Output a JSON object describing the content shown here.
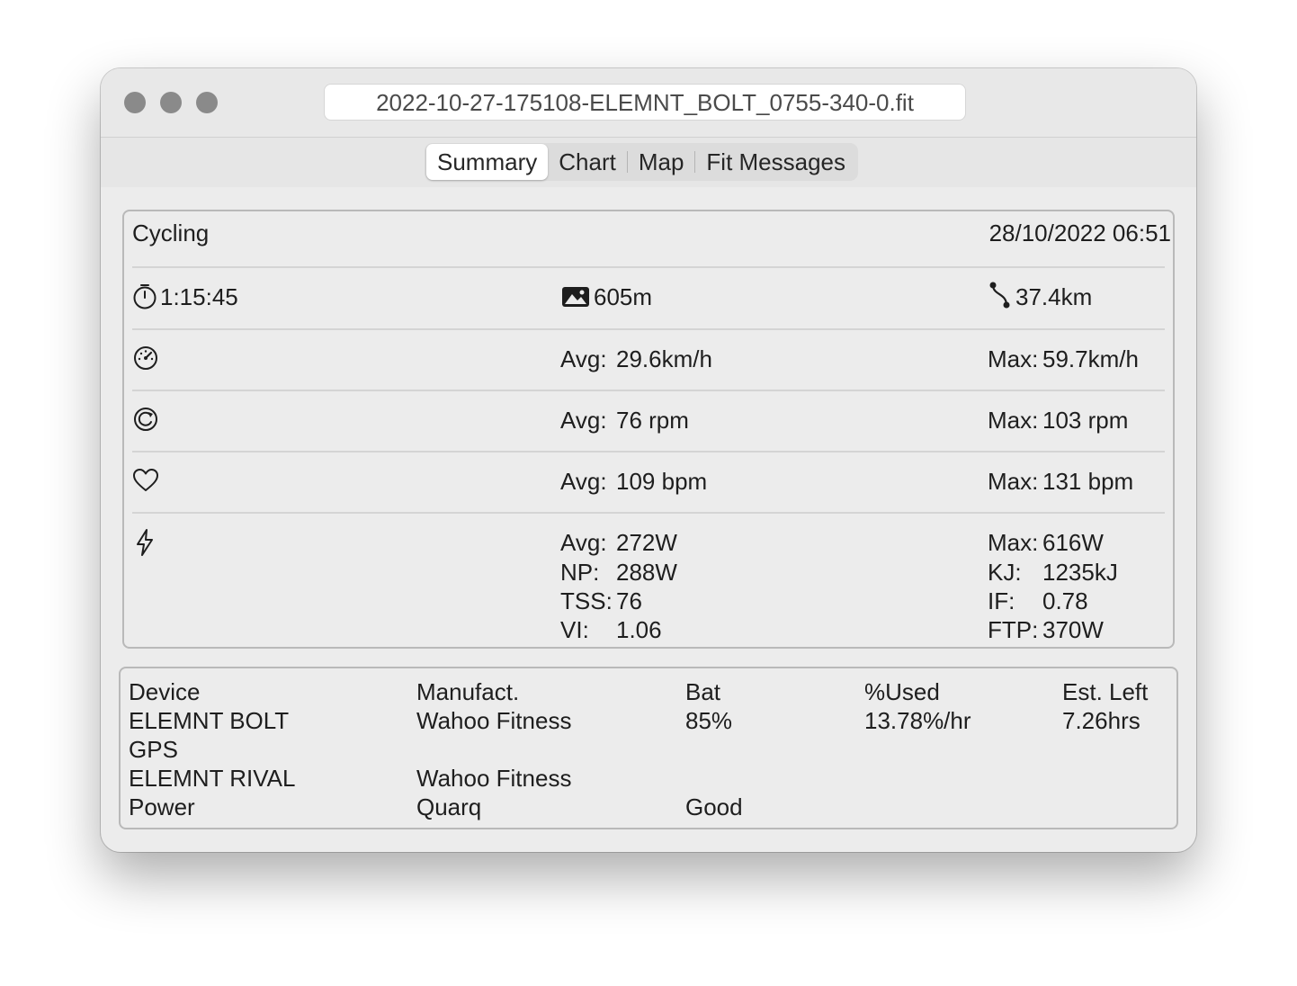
{
  "window": {
    "title": "2022-10-27-175108-ELEMNT_BOLT_0755-340-0.fit"
  },
  "tabs": [
    "Summary",
    "Chart",
    "Map",
    "Fit Messages"
  ],
  "summary": {
    "activity": "Cycling",
    "datetime": "28/10/2022 06:51",
    "duration": "1:15:45",
    "ascent": "605m",
    "distance": "37.4km",
    "speed": {
      "avg_label": "Avg:",
      "avg": "29.6km/h",
      "max_label": "Max:",
      "max": "59.7km/h"
    },
    "cadence": {
      "avg_label": "Avg:",
      "avg": "76 rpm",
      "max_label": "Max:",
      "max": "103 rpm"
    },
    "heart": {
      "avg_label": "Avg:",
      "avg": "109 bpm",
      "max_label": "Max:",
      "max": "131 bpm"
    },
    "power": {
      "left": [
        {
          "label": "Avg:",
          "value": "272W"
        },
        {
          "label": "NP:",
          "value": "288W"
        },
        {
          "label": "TSS:",
          "value": "76"
        },
        {
          "label": "VI:",
          "value": "1.06"
        }
      ],
      "right": [
        {
          "label": "Max:",
          "value": "616W"
        },
        {
          "label": "KJ:",
          "value": "1235kJ"
        },
        {
          "label": "IF:",
          "value": "0.78"
        },
        {
          "label": "FTP:",
          "value": "370W"
        }
      ]
    }
  },
  "devices": {
    "headers": [
      "Device",
      "Manufact.",
      "Bat",
      "%Used",
      "Est. Left"
    ],
    "rows": [
      [
        "ELEMNT BOLT",
        "Wahoo Fitness",
        "85%",
        "13.78%/hr",
        "7.26hrs"
      ],
      [
        "GPS",
        "",
        "",
        "",
        ""
      ],
      [
        "ELEMNT RIVAL",
        "Wahoo Fitness",
        "",
        "",
        ""
      ],
      [
        "Power",
        "Quarq",
        "Good",
        "",
        ""
      ]
    ]
  },
  "icons": {
    "duration": "stopwatch-icon",
    "ascent": "mountain-photo-icon",
    "distance": "route-icon",
    "speed": "speedometer-icon",
    "cadence": "cadence-icon",
    "heart": "heart-icon",
    "power": "bolt-icon"
  }
}
